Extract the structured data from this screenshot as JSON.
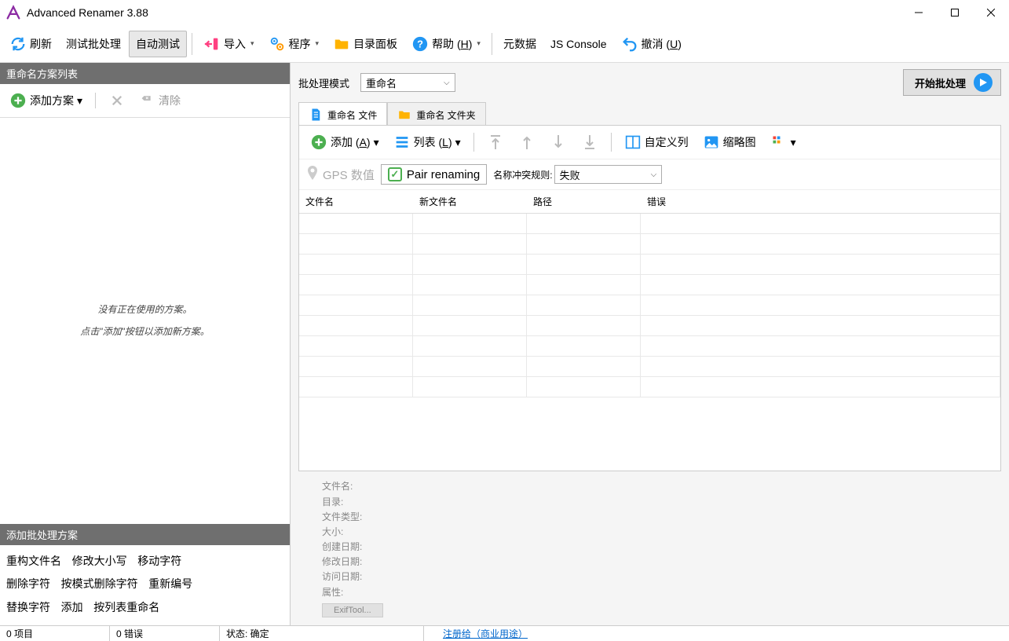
{
  "title": "Advanced Renamer 3.88",
  "toolbar": {
    "refresh": "刷新",
    "testBatch": "测试批处理",
    "autoTest": "自动测试",
    "import": "导入",
    "program": "程序",
    "dirPanel": "目录面板",
    "help": "帮助 (",
    "helpKey": "H",
    "helpEnd": ")",
    "metadata": "元数据",
    "jsConsole": "JS Console",
    "undo": "撤消 (",
    "undoKey": "U",
    "undoEnd": ")"
  },
  "left": {
    "methodsHeader": "重命名方案列表",
    "addMethod": "添加方案",
    "clear": "清除",
    "placeholder1": "没有正在使用的方案。",
    "placeholder2": "点击\"添加\"按钮以添加新方案。",
    "presetsHeader": "添加批处理方案",
    "presets": [
      "重构文件名",
      "修改大小写",
      "移动字符",
      "删除字符",
      "按模式删除字符",
      "重新编号",
      "替换字符",
      "添加",
      "按列表重命名"
    ]
  },
  "right": {
    "batchModeLabel": "批处理模式",
    "batchModeValue": "重命名",
    "startBatch": "开始批处理",
    "tabs": {
      "files": "重命名 文件",
      "folders": "重命名 文件夹"
    },
    "fileToolbar": {
      "add": "添加 (",
      "addKey": "A",
      "addEnd": ")",
      "list": "列表 (",
      "listKey": "L",
      "listEnd": ")",
      "customCols": "自定义列",
      "thumbnails": "缩略图"
    },
    "gps": "GPS 数值",
    "pair": "Pair renaming",
    "collisionLabel": "名称冲突规则:",
    "collisionValue": "失败",
    "columns": {
      "filename": "文件名",
      "newFilename": "新文件名",
      "path": "路径",
      "error": "错误"
    },
    "info": {
      "filename": "文件名:",
      "directory": "目录:",
      "filetype": "文件类型:",
      "size": "大小:",
      "created": "创建日期:",
      "modified": "修改日期:",
      "accessed": "访问日期:",
      "attrs": "属性:",
      "exif": "ExifTool..."
    }
  },
  "status": {
    "items": "0 项目",
    "errors": "0 错误",
    "state": "状态: 确定",
    "register": "注册给（商业用途）"
  }
}
